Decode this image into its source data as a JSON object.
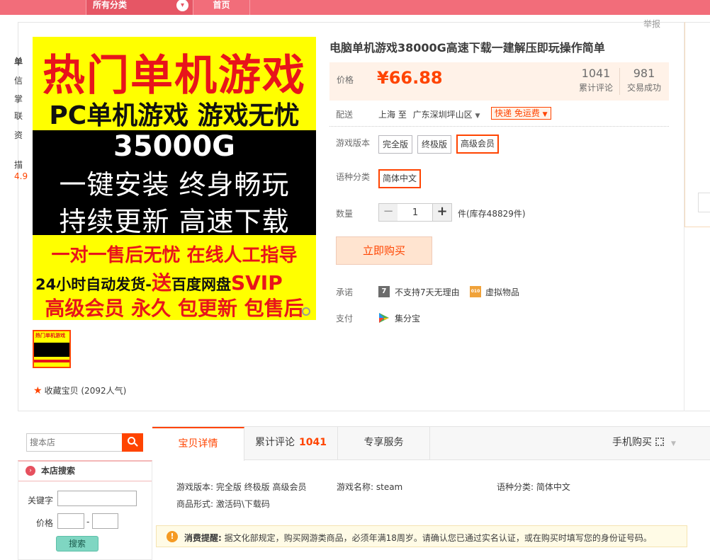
{
  "topbar": {
    "category_label": "所有分类",
    "home_label": "首页"
  },
  "report_label": "举报",
  "poster": {
    "line1": "热门单机游戏",
    "line2": "PC单机游戏 游戏无忧",
    "line3": "35000G",
    "line4": "一键安装 终身畅玩",
    "line5": "持续更新 高速下载",
    "line6": "一对一售后无忧 在线人工指导",
    "line7a": "24小时自动发货-",
    "line7b": "送",
    "line7c": "百度网盘",
    "line7d": "SVIP",
    "line8": "高级会员 永久 包更新 包售后"
  },
  "thumb": {
    "text": "热门单机游戏"
  },
  "favorite": {
    "label": "收藏宝贝 (2092人气)"
  },
  "product": {
    "title": "电脑单机游戏38000G高速下载一建解压即玩操作简单",
    "price_label": "价格",
    "price": "¥66.88",
    "reviews_count": "1041",
    "reviews_label": "累计评论",
    "sales_count": "981",
    "sales_label": "交易成功"
  },
  "shipping": {
    "label": "配送",
    "from": "上海 至",
    "to": "广东深圳坪山区",
    "badge": "快递 免运费"
  },
  "version": {
    "label": "游戏版本",
    "options": [
      "完全版",
      "终极版",
      "高级会员"
    ],
    "selected": "高级会员"
  },
  "language": {
    "label": "语种分类",
    "options": [
      "简体中文"
    ],
    "selected": "简体中文"
  },
  "quantity": {
    "label": "数量",
    "value": "1",
    "stock": "件(库存48829件)"
  },
  "buy_label": "立即购买",
  "promise": {
    "label": "承诺",
    "item1_icon": "7",
    "item1": "不支持7天无理由",
    "item2_icon": "010",
    "item2": "虚拟物品"
  },
  "payment": {
    "label": "支付",
    "method": "集分宝"
  },
  "right_panel": {
    "l1": "单",
    "l2": "信",
    "l3": "掌",
    "l4": "联",
    "l5": "资",
    "l6": "描",
    "l7": "4.9"
  },
  "store_search": {
    "placeholder": "搜本店",
    "title": "本店搜索",
    "keyword_label": "关键字",
    "price_label": "价格",
    "dash": "-",
    "button": "搜索"
  },
  "tabs": {
    "details": "宝贝详情",
    "reviews": "累计评论",
    "reviews_count": "1041",
    "service": "专享服务",
    "mobile": "手机购买"
  },
  "attributes": {
    "a1": "游戏版本: 完全版 终极版 高级会员",
    "a2": "游戏名称: steam",
    "a3": "语种分类: 简体中文",
    "a4": "商品形式: 激活码\\下载码"
  },
  "notice": {
    "title": "消费提醒:",
    "text": "据文化部规定，购买网游类商品，必须年满18周岁。请确认您已通过实名认证，或在购买时填写您的身份证号码。"
  },
  "colors": {
    "accent": "#ff4400",
    "topbar": "#f26d7a",
    "poster_bg": "#ffff00",
    "poster_red": "#e8141b"
  }
}
